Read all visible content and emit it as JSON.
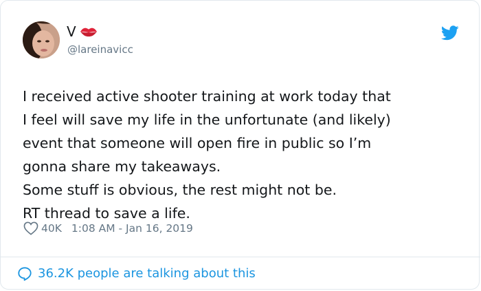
{
  "user": {
    "display_name": "V",
    "handle": "@lareinavicc"
  },
  "icons": {
    "avatar": "profile-photo",
    "name_emoji": "kiss-mark-icon",
    "brand": "twitter-bird-icon",
    "like": "heart-outline-icon",
    "reply": "speech-bubble-icon"
  },
  "tweet": {
    "lines": [
      "I received active shooter training at work today that",
      "I feel will save my life in the unfortunate (and likely)",
      "event that someone will open fire in public so I’m",
      "gonna share my takeaways.",
      "Some stuff is obvious, the rest might not be.",
      "RT thread to save a life."
    ],
    "likes": "40K",
    "timestamp": "1:08 AM - Jan 16, 2019"
  },
  "footer": {
    "talking_text": "36.2K people are talking about this"
  },
  "colors": {
    "twitter_blue": "#1da1f2",
    "link_blue": "#1b95e0",
    "kiss_red": "#e0243a",
    "text": "#14171a",
    "muted": "#657786",
    "border": "#e1e8ed"
  }
}
